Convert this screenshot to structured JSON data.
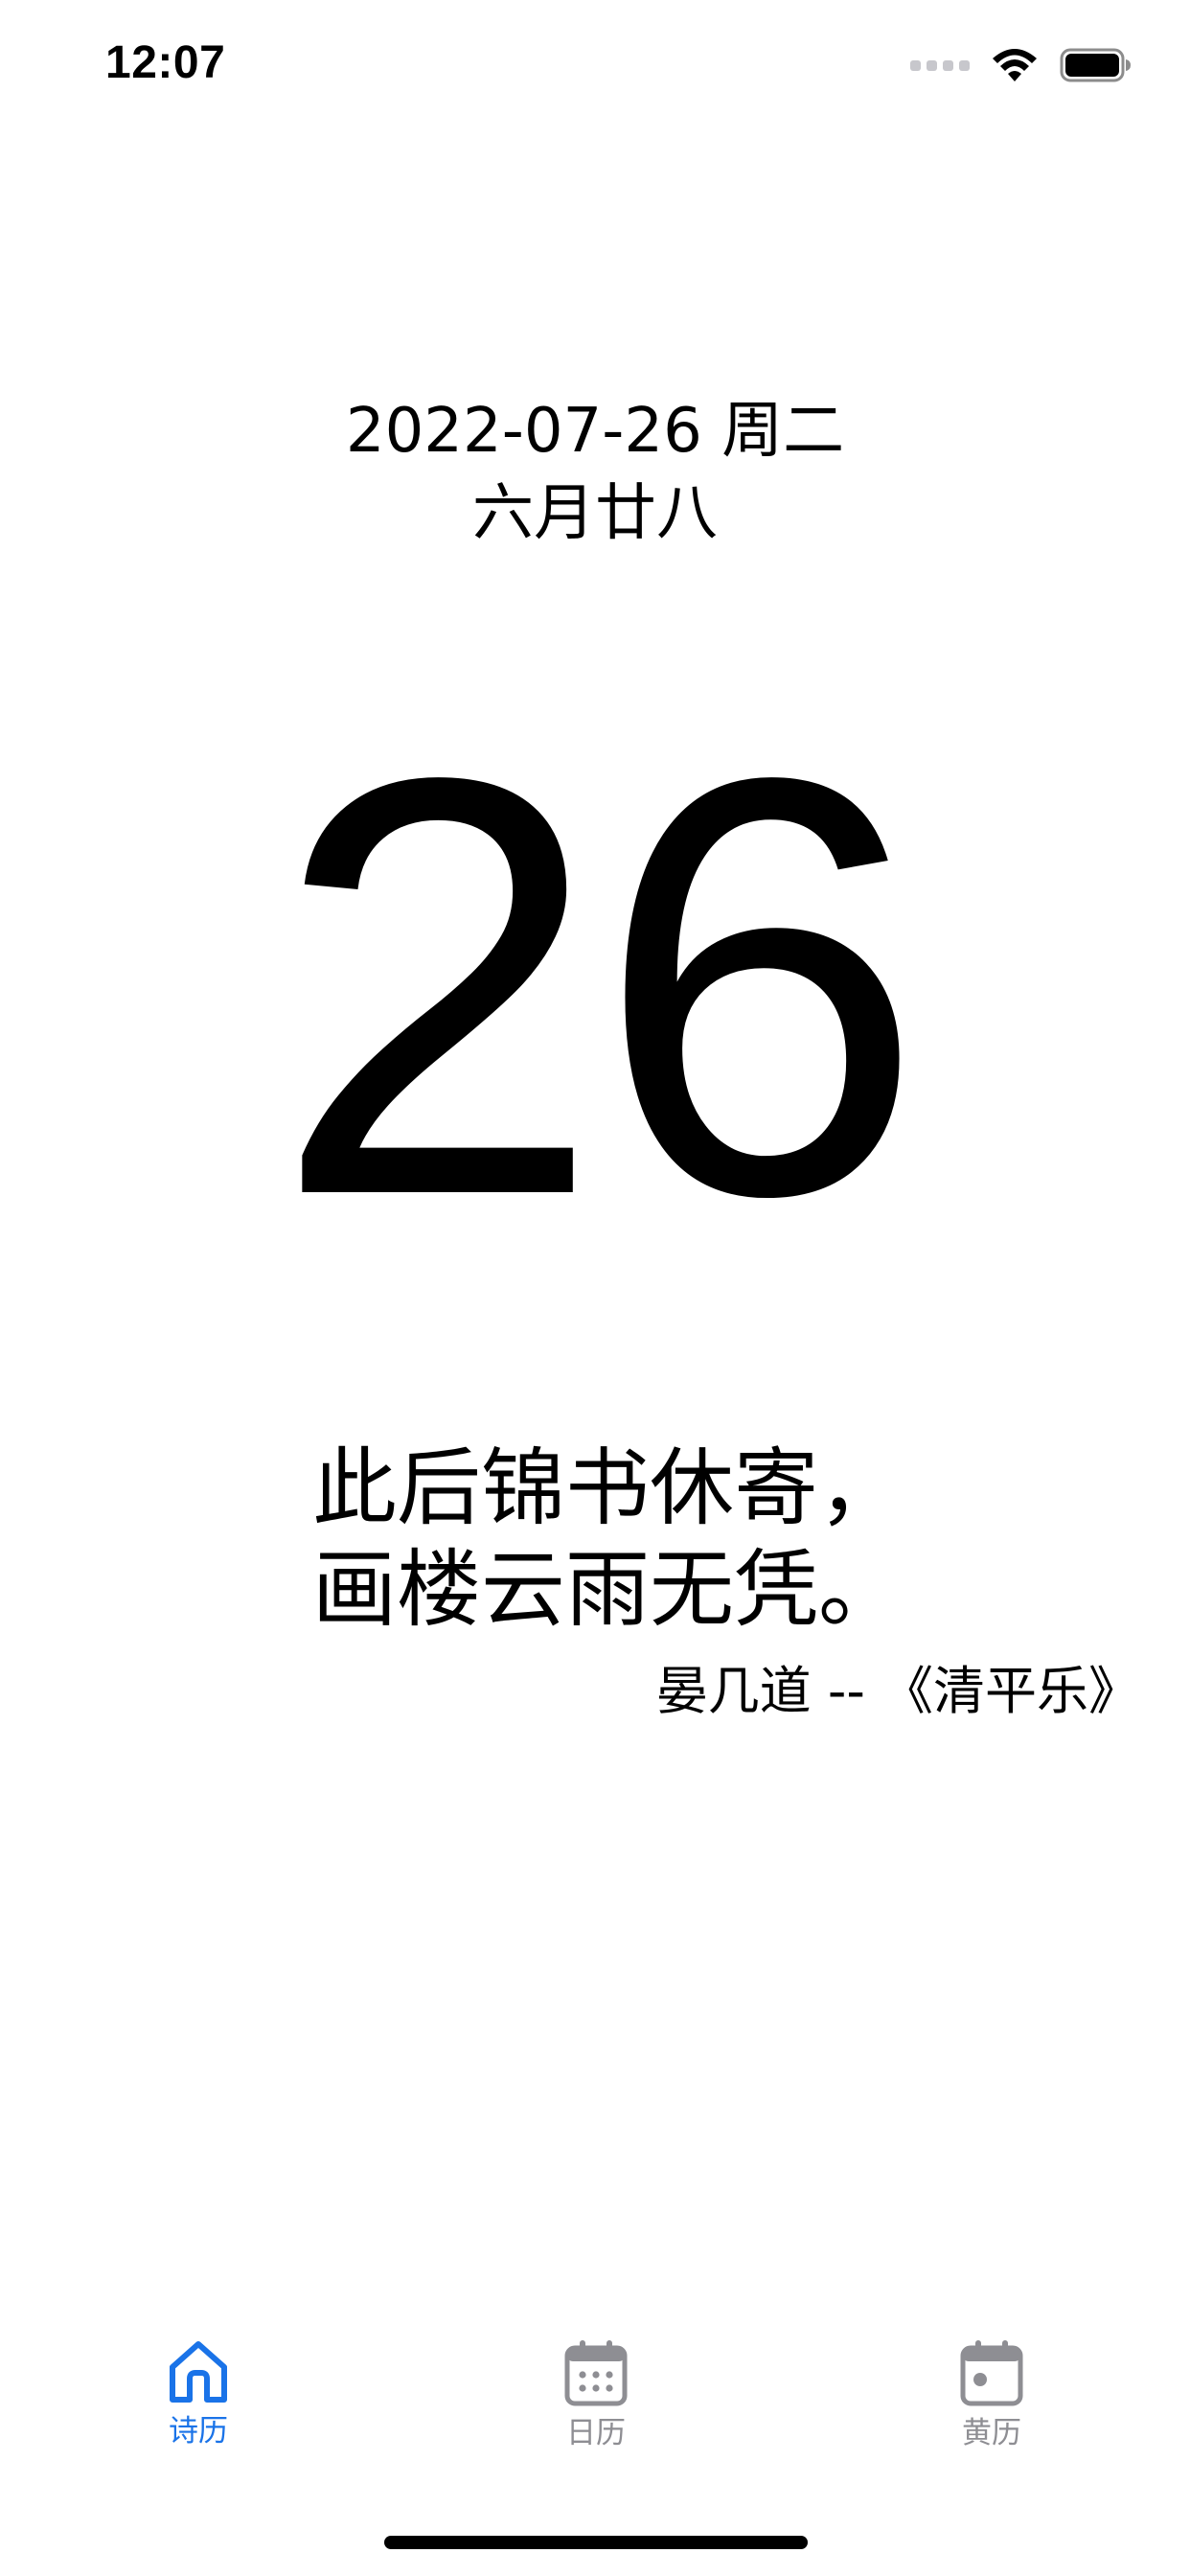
{
  "status_bar": {
    "time": "12:07"
  },
  "date": {
    "gregorian": "2022-07-26 周二",
    "lunar": "六月廿八",
    "day": "26"
  },
  "poem": {
    "lines": [
      "此后锦书休寄，",
      "画楼云雨无凭。"
    ],
    "attribution": "晏几道 -- 《清平乐》"
  },
  "tabs": [
    {
      "label": "诗历",
      "icon": "home-icon",
      "active": true
    },
    {
      "label": "日历",
      "icon": "calendar-icon",
      "active": false
    },
    {
      "label": "黄历",
      "icon": "calendar-day-icon",
      "active": false
    }
  ],
  "colors": {
    "accent": "#1a73e8",
    "inactive": "#8e8e93",
    "text": "#000000",
    "background": "#ffffff"
  }
}
